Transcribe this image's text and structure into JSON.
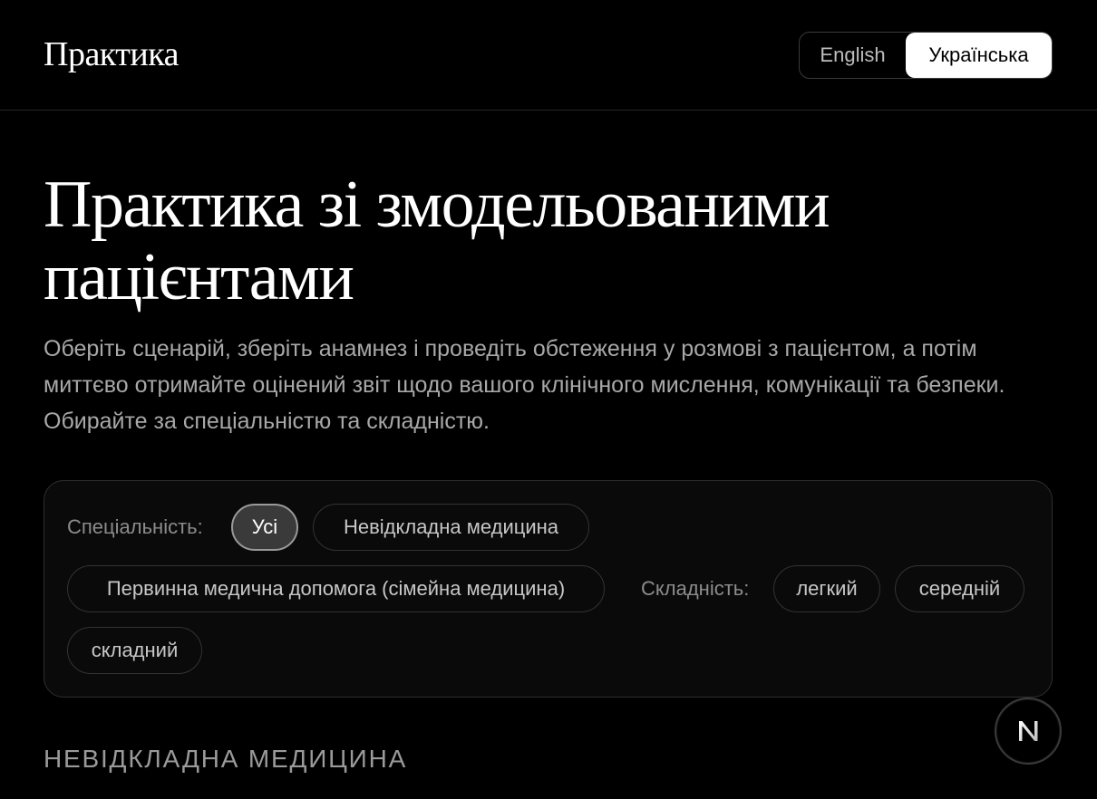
{
  "header": {
    "brand": "Практика",
    "languages": {
      "english": "English",
      "ukrainian": "Українська",
      "selected": "Українська"
    }
  },
  "hero": {
    "title": "Практика зі змодельованими пацієнтами",
    "description": "Оберіть сценарій, зберіть анамнез і проведіть обстеження у розмові з пацієнтом, а потім миттєво отримайте оцінений звіт щодо вашого клінічного мислення, комунікації та безпеки. Обирайте за спеціальністю та складністю."
  },
  "filters": {
    "specialty_label": "Спеціальність:",
    "specialties": [
      {
        "label": "Усі",
        "active": true
      },
      {
        "label": "Невідкладна медицина",
        "active": false
      },
      {
        "label": "Первинна медична допомога (сімейна медицина)",
        "active": false
      }
    ],
    "difficulty_label": "Складність:",
    "difficulties": [
      {
        "label": "легкий"
      },
      {
        "label": "середній"
      },
      {
        "label": "складний"
      }
    ]
  },
  "section": {
    "heading": "НЕВІДКЛАДНА МЕДИЦИНА"
  },
  "floating_button": {
    "icon": "next-logo-icon",
    "letter": "N"
  },
  "colors": {
    "background": "#000000",
    "accent": "#ffffff",
    "muted_text": "#a8a8a8"
  }
}
